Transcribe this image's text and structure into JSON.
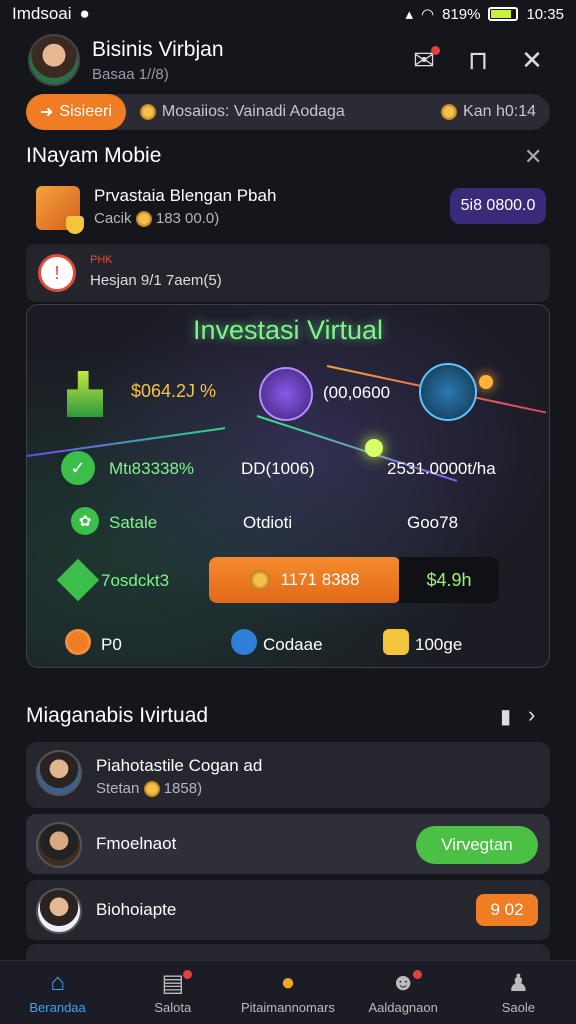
{
  "status": {
    "carrier": "Imdsoai",
    "battery": "819%",
    "time": "10:35"
  },
  "header": {
    "title": "Bisinis Virbjan",
    "subtitle": "Basaa 1//8)"
  },
  "marquee": {
    "pill_label": "Sisieeri",
    "middle_text": "Mosaiios: Vainadi Aodaga",
    "right_text": "Kan h0:14"
  },
  "notice_section": {
    "title": "INayam Mobie"
  },
  "shop_row": {
    "title": "Prvastaia Blengan Pbah",
    "sub_label": "Cacik",
    "sub_value": "183 00.0)",
    "badge": "5i8 0800.0"
  },
  "alert_row": {
    "tag": "PHK",
    "text": "Hesjan 9/1 7aem(5)"
  },
  "invest": {
    "title": "Investasi Virtual",
    "value_left": "$064.2J %",
    "value_mid": "(00,0600",
    "row2_left": "Mtι83338%",
    "row2_mid": "DD(1006)",
    "row2_right": "2531.0000t/ha",
    "row3_left": "Satale",
    "row3_mid": "Otdioti",
    "row3_right": "Goo78",
    "row4_left": "7osdckt3",
    "button_value": "1171 8388",
    "button_right": "$4.9h",
    "footer_left": "P0",
    "footer_mid": "Codaae",
    "footer_right": "100ge"
  },
  "list_section": {
    "title": "Miaganabis Ivirtuad",
    "items": [
      {
        "title": "Piahotastile Cogan   ad",
        "sub_label": "Stetan",
        "sub_value": "1858)"
      },
      {
        "title": "Fmoelnaot",
        "action": "Virvegtan"
      },
      {
        "title": "Biohoiapte",
        "action": "9 02"
      }
    ]
  },
  "bottom_nav": [
    {
      "label": "Berandaa",
      "icon": "home-icon"
    },
    {
      "label": "Salota",
      "icon": "document-icon"
    },
    {
      "label": "Pitaimannomars",
      "icon": "chat-icon"
    },
    {
      "label": "Aaldagnaon",
      "icon": "user-icon"
    },
    {
      "label": "Saole",
      "icon": "profile-icon"
    }
  ],
  "colors": {
    "accent_orange": "#f07d23",
    "accent_green": "#4cbf45",
    "active_nav": "#3ba3f0",
    "purple_badge": "#3b2a7a"
  }
}
